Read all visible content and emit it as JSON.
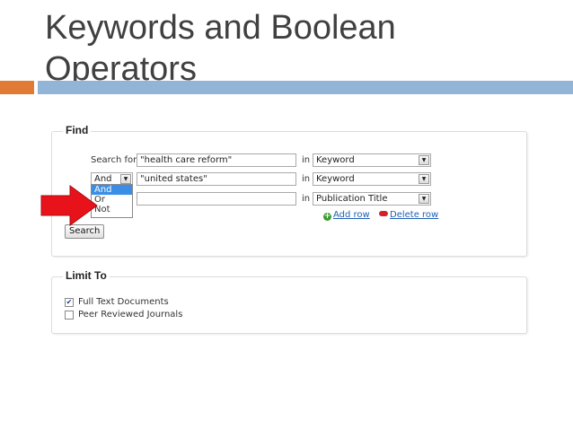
{
  "slide": {
    "title_line1": "Keywords and Boolean",
    "title_line2": "Operators"
  },
  "find": {
    "legend": "Find",
    "search_for_label": "Search for",
    "row1": {
      "term": "\"health care reform\"",
      "in_label": "in",
      "field": "Keyword"
    },
    "row2": {
      "operator": "And",
      "term": "\"united states\"",
      "in_label": "in",
      "field": "Keyword"
    },
    "row3": {
      "term": "",
      "in_label": "in",
      "field": "Publication Title"
    },
    "operator_options": [
      "And",
      "Or",
      "Not"
    ],
    "add_row_label": "Add row",
    "delete_row_label": "Delete row",
    "search_button_label": "Search"
  },
  "limit_to": {
    "legend": "Limit To",
    "options": [
      {
        "label": "Full Text Documents",
        "checked": true
      },
      {
        "label": "Peer Reviewed Journals",
        "checked": false
      }
    ]
  },
  "colors": {
    "orange_bar": "#e07a34",
    "blue_bar": "#92b4d6",
    "arrow_red": "#e8121b",
    "link_blue": "#1d5fb5",
    "selected_option": "#3a8ee6"
  },
  "icons": {
    "add_row": "plus-circle-icon",
    "delete_row": "minus-pill-icon",
    "dropdown": "chevron-down-icon",
    "checkbox": "checkmark-icon",
    "pointer": "arrow-right-icon"
  }
}
